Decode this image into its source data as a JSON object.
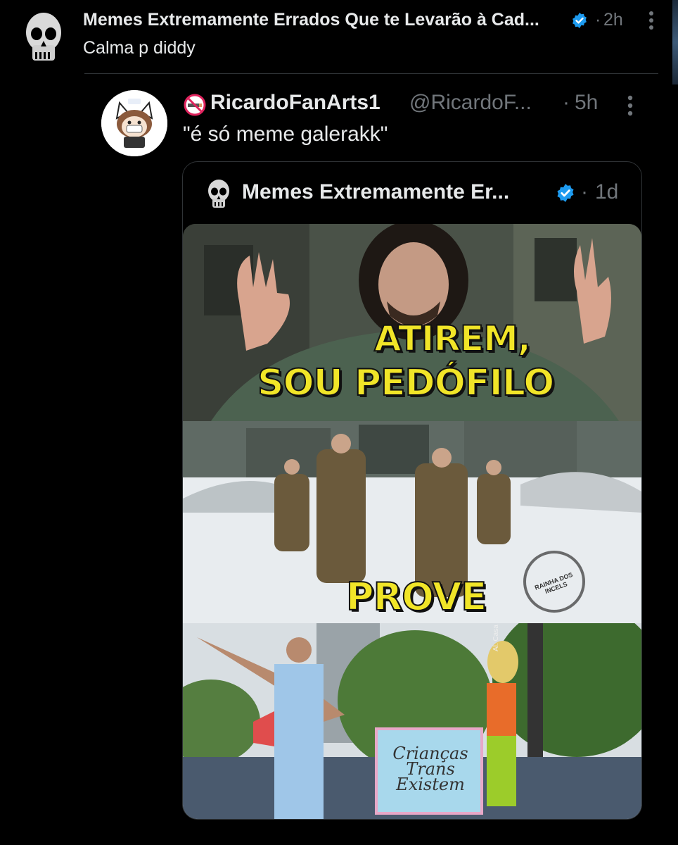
{
  "reply": {
    "author": "Memes Extremamente Errados Que te Levarão à Cad...",
    "separator": "·",
    "time": "2h",
    "text": "Calma p diddy"
  },
  "post": {
    "author_emoji": "🚭",
    "author": "RicardoFanArts1",
    "handle": "@RicardoF...",
    "separator": "·",
    "time": "5h",
    "text": "\"é só meme galerakk\""
  },
  "quote": {
    "author": "Memes Extremamente Er...",
    "separator": "·",
    "time": "1d",
    "meme": {
      "panel1_line1": "ATIREM,",
      "panel1_line2": "SOU PEDÓFILO",
      "panel2_caption": "PROVE",
      "panel2_watermark": "RAINHA DOS INCELS",
      "panel3_sign": [
        "Crianças",
        "Trans",
        "Existem"
      ],
      "panel3_street_sign": "Al. Casa Branca"
    }
  },
  "colors": {
    "background": "#000000",
    "text_primary": "#e7e9ea",
    "text_secondary": "#71767b",
    "verified": "#1d9bf0",
    "meme_caption": "#f1e528"
  },
  "icons": {
    "verified": "verified-badge-icon",
    "more": "more-options-icon",
    "no_smoking": "no-smoking-icon"
  }
}
